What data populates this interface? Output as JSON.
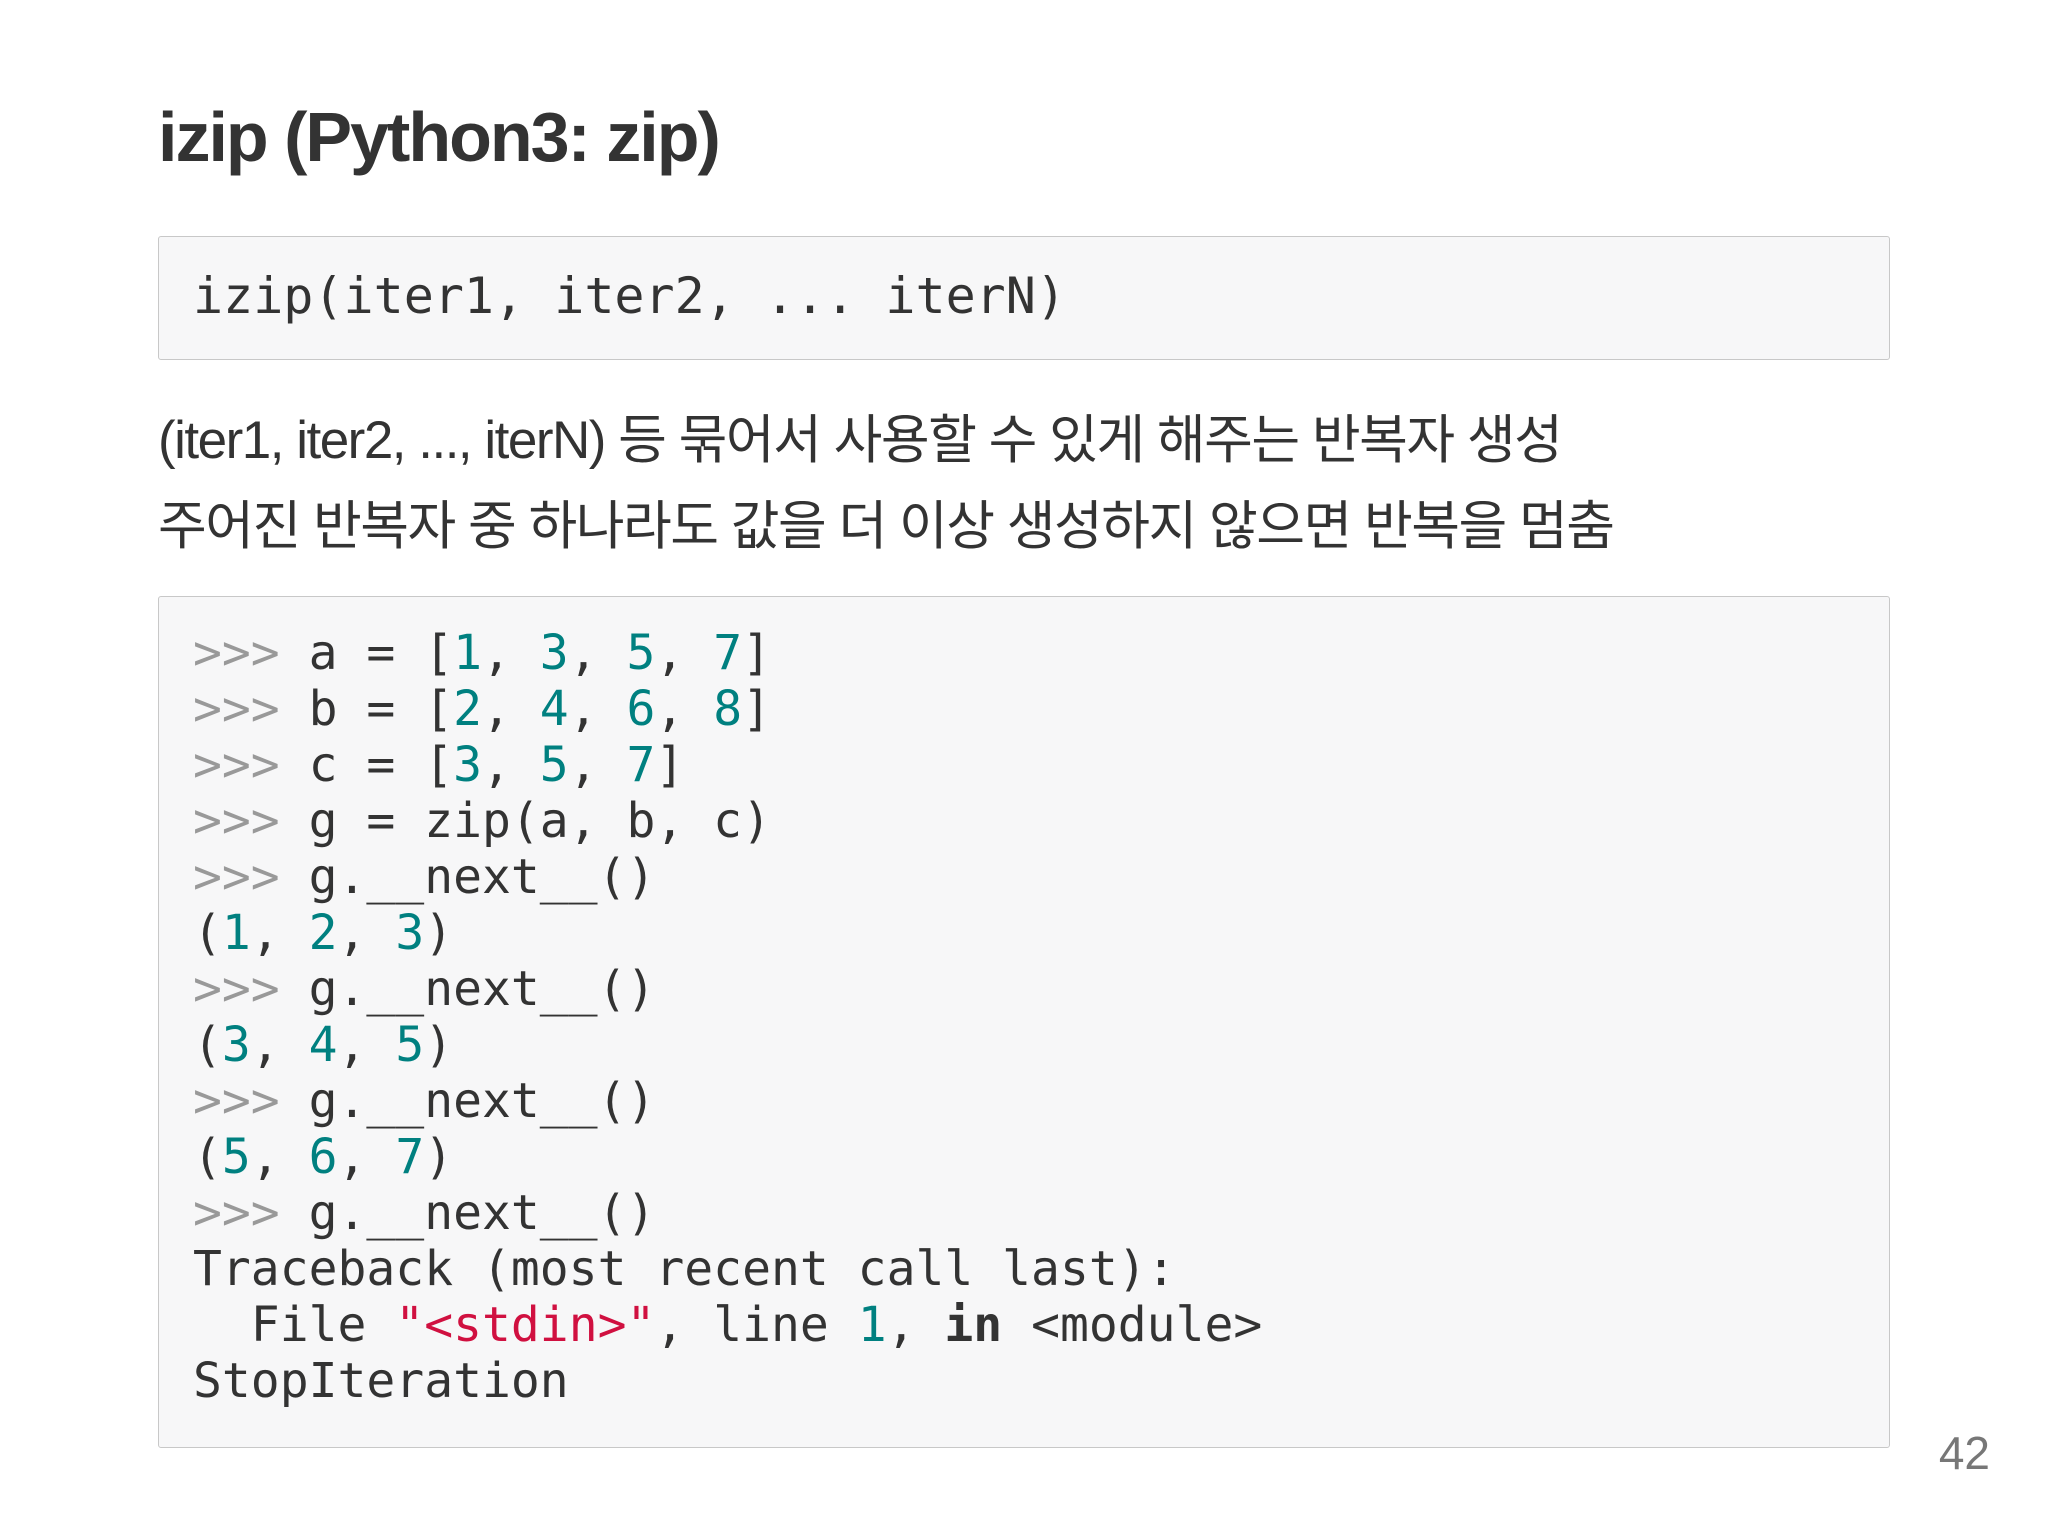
{
  "slide": {
    "title": "izip (Python3: zip)",
    "signature": "izip(iter1, iter2, ... iterN)",
    "description": [
      "(iter1, iter2, ..., iterN) 등 묶어서 사용할 수 있게 해주는 반복자 생성",
      "주어진 반복자 중 하나라도 값을 더 이상 생성하지 않으면 반복을 멈춤"
    ],
    "page_number": "42"
  },
  "repl": {
    "prompt": ">>> ",
    "l1": {
      "code": "a = [",
      "n1": "1",
      "s1": ", ",
      "n2": "3",
      "s2": ", ",
      "n3": "5",
      "s3": ", ",
      "n4": "7",
      "end": "]"
    },
    "l2": {
      "code": "b = [",
      "n1": "2",
      "s1": ", ",
      "n2": "4",
      "s2": ", ",
      "n3": "6",
      "s3": ", ",
      "n4": "8",
      "end": "]"
    },
    "l3": {
      "code": "c = [",
      "n1": "3",
      "s1": ", ",
      "n2": "5",
      "s2": ", ",
      "n3": "7",
      "end": "]"
    },
    "l4": {
      "code": "g = zip(a, b, c)"
    },
    "next_call": "g.__next__()",
    "out1": {
      "open": "(",
      "n1": "1",
      "s1": ", ",
      "n2": "2",
      "s2": ", ",
      "n3": "3",
      "close": ")"
    },
    "out2": {
      "open": "(",
      "n1": "3",
      "s1": ", ",
      "n2": "4",
      "s2": ", ",
      "n3": "5",
      "close": ")"
    },
    "out3": {
      "open": "(",
      "n1": "5",
      "s1": ", ",
      "n2": "6",
      "s2": ", ",
      "n3": "7",
      "close": ")"
    },
    "traceback": "Traceback (most recent call last):",
    "file_pre": "  File ",
    "file_str": "\"<stdin>\"",
    "file_mid": ", line ",
    "file_num": "1",
    "file_comma": ", ",
    "file_kw": "in",
    "file_end": " <module>",
    "error": "StopIteration"
  },
  "colors": {
    "text": "#333333",
    "prompt": "#999999",
    "number": "#008080",
    "string": "#d01040",
    "code_bg": "#f7f7f8",
    "code_border": "#c8c8c8"
  }
}
